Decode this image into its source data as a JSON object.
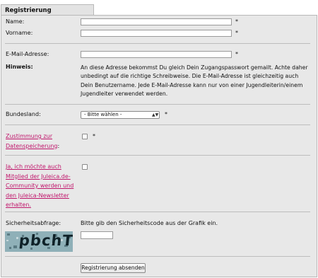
{
  "form": {
    "tab_title": "Registrierung",
    "name_label": "Name:",
    "vorname_label": "Vorname:",
    "email_label": "E-Mail-Adresse:",
    "hinweis_label": "Hinweis:",
    "hinweis_text": "An diese Adresse bekommst Du gleich Dein Zugangspasswort gemailt. Achte daher unbedingt auf die richtige Schreibweise. Die E-Mail-Adresse ist gleichzeitig auch Dein Benutzername. Jede E-Mail-Adresse kann nur von einer Jugendleiterin/einem Jugendleiter verwendet werden.",
    "bundesland_label": "Bundesland:",
    "bundesland_selected": "- Bitte wählen -",
    "zustimmung_label_1": "Zustimmung zur",
    "zustimmung_label_2": "Datenspeicherung",
    "zustimmung_colon": ":",
    "mitglied_label_1": "Ja, ich möchte auch",
    "mitglied_label_2": "Mitglied der Juleica.de-",
    "mitglied_label_3": "Community werden und",
    "mitglied_label_4": "den Juleica-Newsletter",
    "mitglied_label_5": "erhalten.",
    "sicherheit_label": "Sicherheitsabfrage:",
    "sicherheit_text": "Bitte gib den Sicherheitscode aus der Grafik ein.",
    "captcha_text": "pbchT",
    "required_mark": "*",
    "submit_label": "Registrierung absenden",
    "name_value": "",
    "vorname_value": "",
    "email_value": "",
    "captcha_value": ""
  },
  "colors": {
    "panel_bg": "#e8e8e8",
    "link_pink": "#c0156b",
    "border": "#b8b8b8"
  }
}
